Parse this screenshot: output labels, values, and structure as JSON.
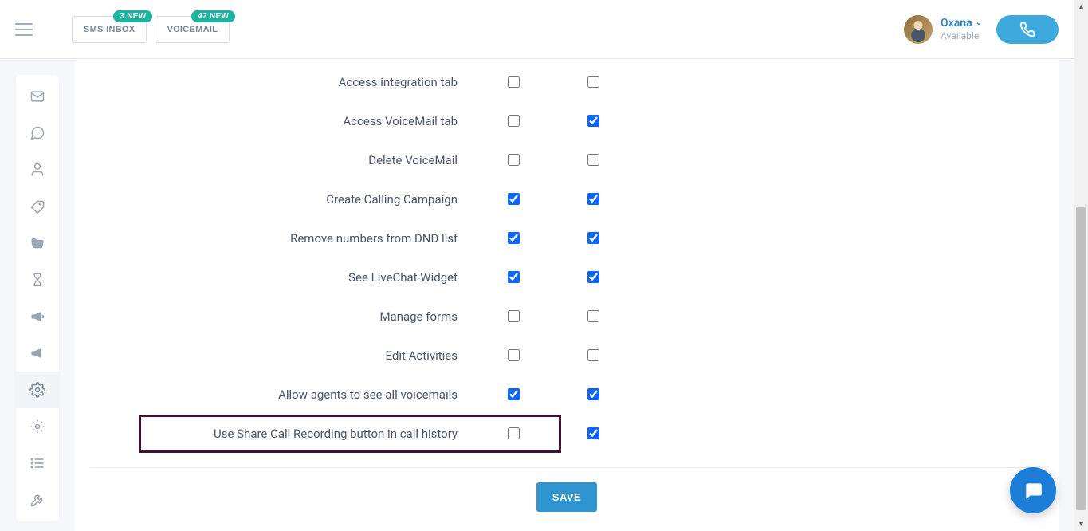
{
  "header": {
    "sms_inbox_label": "SMS INBOX",
    "sms_inbox_badge": "3 NEW",
    "voicemail_label": "VOICEMAIL",
    "voicemail_badge": "42 NEW",
    "user_name": "Oxana",
    "user_status": "Available"
  },
  "sidebar": {
    "items": [
      {
        "name": "mail-icon"
      },
      {
        "name": "chat-icon"
      },
      {
        "name": "person-icon"
      },
      {
        "name": "tag-icon"
      },
      {
        "name": "folder-icon"
      },
      {
        "name": "hourglass-icon"
      },
      {
        "name": "megaphone-icon"
      },
      {
        "name": "megaphone2-icon"
      },
      {
        "name": "gear-icon",
        "active": true
      },
      {
        "name": "gear2-icon"
      },
      {
        "name": "list-icon"
      },
      {
        "name": "wrench-icon"
      }
    ]
  },
  "permissions": {
    "rows": [
      {
        "label": "Access integration tab",
        "col1": false,
        "col2": false
      },
      {
        "label": "Access VoiceMail tab",
        "col1": false,
        "col2": true
      },
      {
        "label": "Delete VoiceMail",
        "col1": false,
        "col2": false
      },
      {
        "label": "Create Calling Campaign",
        "col1": true,
        "col2": true
      },
      {
        "label": "Remove numbers from DND list",
        "col1": true,
        "col2": true
      },
      {
        "label": "See LiveChat Widget",
        "col1": true,
        "col2": true
      },
      {
        "label": "Manage forms",
        "col1": false,
        "col2": false
      },
      {
        "label": "Edit Activities",
        "col1": false,
        "col2": false
      },
      {
        "label": "Allow agents to see all voicemails",
        "col1": true,
        "col2": true
      },
      {
        "label": "Use Share Call Recording button in call history",
        "col1": false,
        "col2": true,
        "highlight": true
      }
    ],
    "save_label": "SAVE"
  },
  "colors": {
    "accent_blue": "#2f94cf",
    "badge_teal": "#19b5a1",
    "fab_blue": "#1c7ed6",
    "highlight_border": "#3f1032"
  }
}
